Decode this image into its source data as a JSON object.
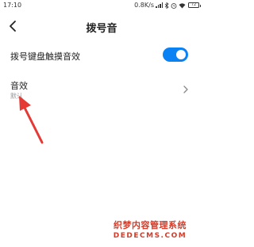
{
  "status_bar": {
    "time": "17:10",
    "network_speed": "0.8K/s",
    "battery_level": "72",
    "icons": [
      "signal-icon",
      "bluetooth-icon",
      "alarm-icon",
      "wifi-icon",
      "battery-icon"
    ]
  },
  "header": {
    "title": "拨号音",
    "back_icon": "back-arrow-icon"
  },
  "settings": {
    "touch_sound": {
      "label": "拨号键盘触摸音效",
      "enabled": true
    },
    "sound_effect": {
      "label": "音效",
      "value": "默认",
      "chevron_icon": "chevron-right-icon"
    }
  },
  "watermark": {
    "cn": "织梦内容管理系统",
    "en": "DEDECMS.COM"
  },
  "colors": {
    "accent": "#0a82f4",
    "annotation": "#e53935",
    "watermark": "#d23c2a",
    "sublabel": "#999999"
  }
}
